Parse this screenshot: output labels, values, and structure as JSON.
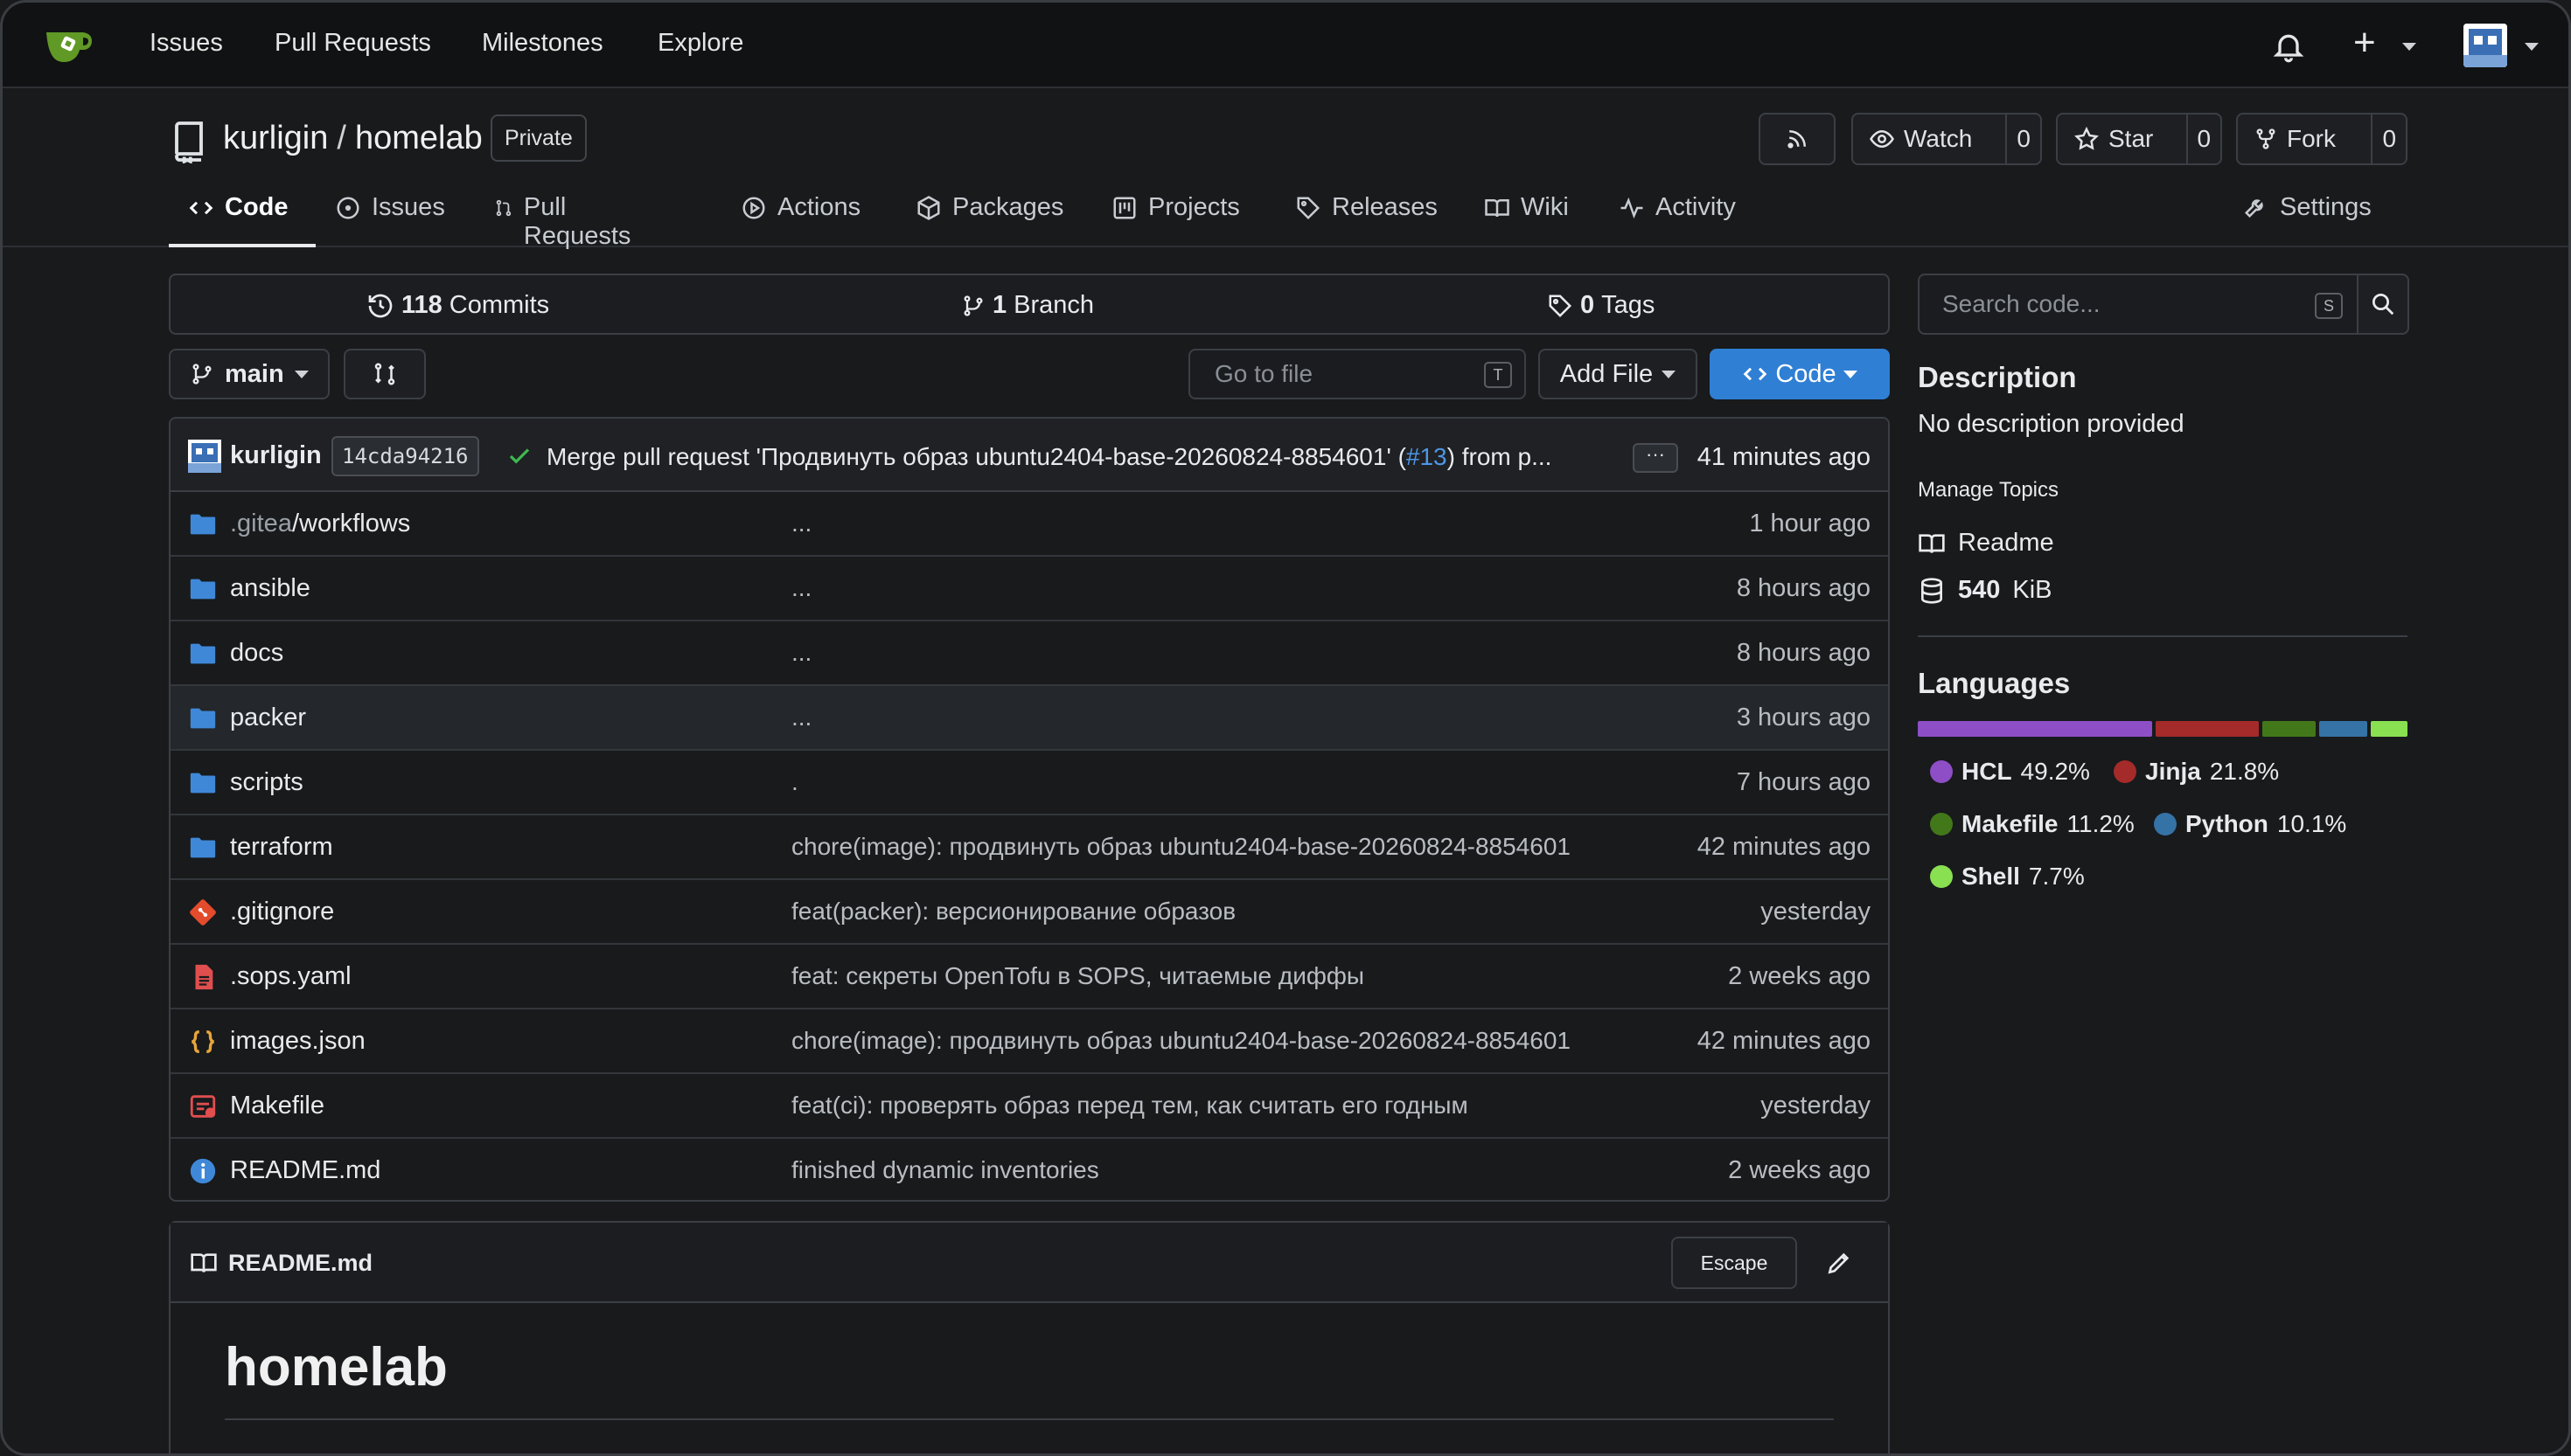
{
  "topnav": {
    "items": [
      "Issues",
      "Pull Requests",
      "Milestones",
      "Explore"
    ],
    "icons": [
      "bell-icon",
      "plus-icon",
      "avatar"
    ]
  },
  "repo": {
    "owner": "kurligin",
    "separator": "/",
    "name": "homelab",
    "visibility": "Private",
    "watch": {
      "label": "Watch",
      "count": "0"
    },
    "star": {
      "label": "Star",
      "count": "0"
    },
    "fork": {
      "label": "Fork",
      "count": "0"
    }
  },
  "tabs": [
    {
      "label": "Code",
      "icon": "code-icon",
      "active": true
    },
    {
      "label": "Issues",
      "icon": "issue-icon"
    },
    {
      "label": "Pull Requests",
      "icon": "pull-request-icon"
    },
    {
      "label": "Actions",
      "icon": "play-icon"
    },
    {
      "label": "Packages",
      "icon": "package-icon"
    },
    {
      "label": "Projects",
      "icon": "project-icon"
    },
    {
      "label": "Releases",
      "icon": "tag-icon"
    },
    {
      "label": "Wiki",
      "icon": "book-icon"
    },
    {
      "label": "Activity",
      "icon": "pulse-icon"
    }
  ],
  "settings_label": "Settings",
  "stats": {
    "commits_count": "118",
    "commits_label": "Commits",
    "branches_count": "1",
    "branches_label": "Branch",
    "tags_count": "0",
    "tags_label": "Tags"
  },
  "toolbar": {
    "branch": "main",
    "goto_placeholder": "Go to file",
    "goto_key": "T",
    "add_file": "Add File",
    "code": "Code"
  },
  "last_commit": {
    "author": "kurligin",
    "sha": "14cda94216",
    "message_prefix": "Merge pull request 'Продвинуть образ ubuntu2404-base-20260824-8854601' (",
    "pr_link": "#13",
    "message_suffix": ") from p...",
    "more": "···",
    "time": "41 minutes ago"
  },
  "files": [
    {
      "dim": ".gitea",
      "name": "/workflows",
      "type": "folder",
      "message": "...",
      "time": "1 hour ago"
    },
    {
      "dim": "",
      "name": "ansible",
      "type": "folder",
      "message": "...",
      "time": "8 hours ago"
    },
    {
      "dim": "",
      "name": "docs",
      "type": "folder",
      "message": "...",
      "time": "8 hours ago"
    },
    {
      "dim": "",
      "name": "packer",
      "type": "folder",
      "message": "...",
      "time": "3 hours ago"
    },
    {
      "dim": "",
      "name": "scripts",
      "type": "folder",
      "message": ".",
      "time": "7 hours ago"
    },
    {
      "dim": "",
      "name": "terraform",
      "type": "folder",
      "message": "chore(image): продвинуть образ ubuntu2404-base-20260824-8854601",
      "time": "42 minutes ago"
    },
    {
      "dim": "",
      "name": ".gitignore",
      "type": "git",
      "message": "feat(packer): версионирование образов",
      "time": "yesterday"
    },
    {
      "dim": "",
      "name": ".sops.yaml",
      "type": "yaml",
      "message": "feat: секреты OpenTofu в SOPS, читаемые диффы",
      "time": "2 weeks ago"
    },
    {
      "dim": "",
      "name": "images.json",
      "type": "json",
      "message": "chore(image): продвинуть образ ubuntu2404-base-20260824-8854601",
      "time": "42 minutes ago"
    },
    {
      "dim": "",
      "name": "Makefile",
      "type": "makefile",
      "message": "feat(ci): проверять образ перед тем, как считать его годным",
      "time": "yesterday"
    },
    {
      "dim": "",
      "name": "README.md",
      "type": "info",
      "message": "finished dynamic inventories",
      "time": "2 weeks ago"
    }
  ],
  "readme": {
    "filename": "README.md",
    "escape": "Escape",
    "heading": "homelab"
  },
  "sidebar": {
    "search_placeholder": "Search code...",
    "search_key": "S",
    "description_title": "Description",
    "description": "No description provided",
    "manage_topics": "Manage Topics",
    "readme": "Readme",
    "size_value": "540",
    "size_unit": "KiB",
    "languages_title": "Languages",
    "languages": [
      {
        "name": "HCL",
        "percent": "49.2%",
        "value": 49.2,
        "color": "#8e4ec6"
      },
      {
        "name": "Jinja",
        "percent": "21.8%",
        "value": 21.8,
        "color": "#a52a2a"
      },
      {
        "name": "Makefile",
        "percent": "11.2%",
        "value": 11.2,
        "color": "#427819"
      },
      {
        "name": "Python",
        "percent": "10.1%",
        "value": 10.1,
        "color": "#3572a5"
      },
      {
        "name": "Shell",
        "percent": "7.7%",
        "value": 7.7,
        "color": "#89e051"
      }
    ]
  },
  "colors": {
    "accent": "#2f7fd4",
    "link": "#4e96e6",
    "success": "#3fb950"
  }
}
